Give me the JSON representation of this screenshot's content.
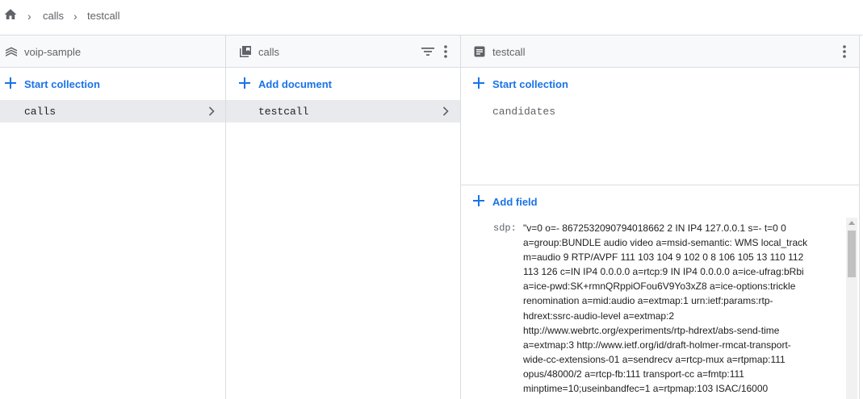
{
  "breadcrumb": {
    "home_icon": "home-icon",
    "items": [
      "calls",
      "testcall"
    ]
  },
  "root_panel": {
    "title": "voip-sample",
    "icon": "firestore-db-icon",
    "add_label": "Start collection",
    "items": [
      {
        "label": "calls",
        "selected": true
      }
    ]
  },
  "collection_panel": {
    "title": "calls",
    "icon": "collection-icon",
    "add_label": "Add document",
    "items": [
      {
        "label": "testcall",
        "selected": true
      }
    ]
  },
  "document_panel": {
    "title": "testcall",
    "icon": "document-icon",
    "add_collection_label": "Start collection",
    "subcollections": [
      "candidates"
    ],
    "add_field_label": "Add field",
    "fields": [
      {
        "key": "sdp:",
        "value_lines": [
          "\"v=0 o=- 8672532090794018662 2 IN IP4 127.0.0.1 s=- t=0 0",
          "a=group:BUNDLE audio video a=msid-semantic: WMS local_track",
          "m=audio 9 RTP/AVPF 111 103 104 9 102 0 8 106 105 13 110 112",
          "113 126 c=IN IP4 0.0.0.0 a=rtcp:9 IN IP4 0.0.0.0 a=ice-ufrag:bRbi",
          "a=ice-pwd:SK+rmnQRppiOFou6V9Yo3xZ8 a=ice-options:trickle",
          "renomination a=mid:audio a=extmap:1 urn:ietf:params:rtp-",
          "hdrext:ssrc-audio-level a=extmap:2",
          "http://www.webrtc.org/experiments/rtp-hdrext/abs-send-time",
          "a=extmap:3 http://www.ietf.org/id/draft-holmer-rmcat-transport-",
          "wide-cc-extensions-01 a=sendrecv a=rtcp-mux a=rtpmap:111",
          "opus/48000/2 a=rtcp-fb:111 transport-cc a=fmtp:111",
          "minptime=10;useinbandfec=1 a=rtpmap:103 ISAC/16000"
        ]
      }
    ]
  },
  "colors": {
    "accent": "#1a73e8",
    "selected_bg": "#e8eaed",
    "header_bg": "#f8f9fa",
    "border": "#dadce0"
  }
}
